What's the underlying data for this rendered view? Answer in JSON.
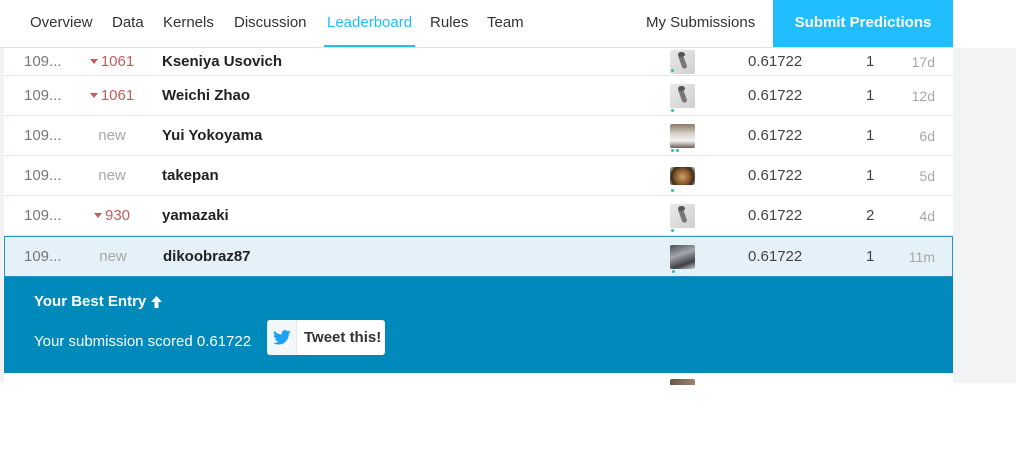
{
  "nav": {
    "tabs": [
      {
        "label": "Overview",
        "active": false
      },
      {
        "label": "Data",
        "active": false
      },
      {
        "label": "Kernels",
        "active": false
      },
      {
        "label": "Discussion",
        "active": false
      },
      {
        "label": "Leaderboard",
        "active": true
      },
      {
        "label": "Rules",
        "active": false
      },
      {
        "label": "Team",
        "active": false
      }
    ],
    "my_submissions": "My Submissions",
    "submit_predictions": "Submit Predictions"
  },
  "leaderboard": {
    "rows": [
      {
        "rank": "109...",
        "change": "1061",
        "change_dir": "down",
        "team": "Kseniya Usovich",
        "avatar": "goose-avatar",
        "score": "0.61722",
        "entries": "1",
        "last": "17d"
      },
      {
        "rank": "109...",
        "change": "1061",
        "change_dir": "down",
        "team": "Weichi Zhao",
        "avatar": "goose-avatar",
        "score": "0.61722",
        "entries": "1",
        "last": "12d"
      },
      {
        "rank": "109...",
        "change": "new",
        "change_dir": "new",
        "team": "Yui Yokoyama",
        "avatar": "photo-avatar",
        "score": "0.61722",
        "entries": "1",
        "last": "6d"
      },
      {
        "rank": "109...",
        "change": "new",
        "change_dir": "new",
        "team": "takepan",
        "avatar": "food-avatar",
        "score": "0.61722",
        "entries": "1",
        "last": "5d"
      },
      {
        "rank": "109...",
        "change": "930",
        "change_dir": "down",
        "team": "yamazaki",
        "avatar": "goose-avatar",
        "score": "0.61722",
        "entries": "2",
        "last": "4d"
      },
      {
        "rank": "109...",
        "change": "new",
        "change_dir": "new",
        "team": "dikoobraz87",
        "avatar": "photo-avatar",
        "score": "0.61722",
        "entries": "1",
        "last": "11m"
      }
    ]
  },
  "best_entry": {
    "title": "Your Best Entry",
    "message": "Your submission scored 0.61722",
    "tweet_label": "Tweet this!"
  },
  "colors": {
    "accent": "#20beff",
    "panel": "#008abc",
    "highlight_row": "#e4f1f8",
    "rank_down": "#c15c5c"
  }
}
